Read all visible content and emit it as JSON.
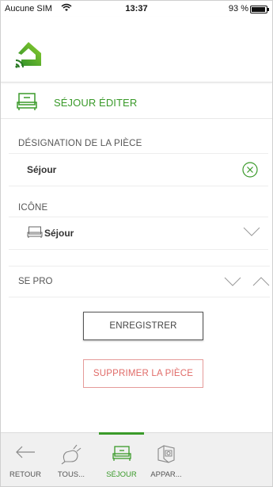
{
  "status_bar": {
    "carrier": "Aucune SIM",
    "time": "13:37",
    "battery": "93 %"
  },
  "colors": {
    "accent": "#3a9a2a",
    "delete": "#e06b68"
  },
  "page": {
    "title": "SÉJOUR ÉDITER"
  },
  "form": {
    "name_label": "DÉSIGNATION DE LA PIÈCE",
    "name_value": "Séjour",
    "icon_label": "ICÔNE",
    "icon_value": "Séjour",
    "section_label": "SE PRO"
  },
  "buttons": {
    "save": "ENREGISTRER",
    "delete": "SUPPRIMER LA PIÈCE"
  },
  "tabs": [
    {
      "label": "RETOUR",
      "icon": "arrow-left-icon",
      "active": false
    },
    {
      "label": "TOUS...",
      "icon": "plug-icon",
      "active": false
    },
    {
      "label": "SÉJOUR",
      "icon": "sofa-icon",
      "active": true
    },
    {
      "label": "APPAR...",
      "icon": "appliance-icon",
      "active": false
    }
  ]
}
